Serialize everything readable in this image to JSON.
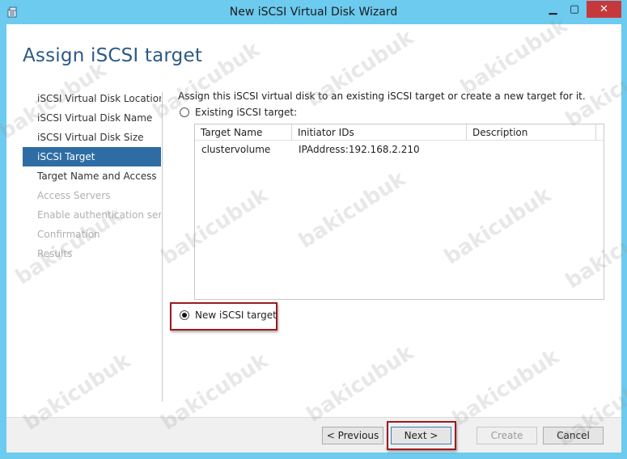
{
  "window": {
    "title": "New iSCSI Virtual Disk Wizard",
    "controls": {
      "minimize": "▁",
      "maximize": "▢",
      "close": "✕"
    }
  },
  "page": {
    "title": "Assign iSCSI target",
    "description": "Assign this iSCSI virtual disk to an existing iSCSI target or create a new target for it."
  },
  "nav": {
    "items": [
      {
        "label": "iSCSI Virtual Disk Location",
        "state": "normal"
      },
      {
        "label": "iSCSI Virtual Disk Name",
        "state": "normal"
      },
      {
        "label": "iSCSI Virtual Disk Size",
        "state": "normal"
      },
      {
        "label": "iSCSI Target",
        "state": "active"
      },
      {
        "label": "Target Name and Access",
        "state": "normal"
      },
      {
        "label": "Access Servers",
        "state": "disabled"
      },
      {
        "label": "Enable authentication ser...",
        "state": "disabled"
      },
      {
        "label": "Confirmation",
        "state": "disabled"
      },
      {
        "label": "Results",
        "state": "disabled"
      }
    ]
  },
  "options": {
    "existing_label": "Existing iSCSI target:",
    "existing_selected": false,
    "new_label": "New iSCSI target",
    "new_selected": true
  },
  "targets_table": {
    "columns": [
      "Target Name",
      "Initiator IDs",
      "Description"
    ],
    "rows": [
      {
        "target_name": "clustervolume",
        "initiator_ids": "IPAddress:192.168.2.210",
        "description": ""
      }
    ]
  },
  "buttons": {
    "previous": "< Previous",
    "next": "Next >",
    "create": "Create",
    "cancel": "Cancel"
  },
  "watermark": "bakicubuk",
  "colors": {
    "title_bar": "#6ccbef",
    "active_nav": "#2e6da4",
    "page_title": "#2d5a86",
    "highlight_border": "#9b1b23"
  }
}
